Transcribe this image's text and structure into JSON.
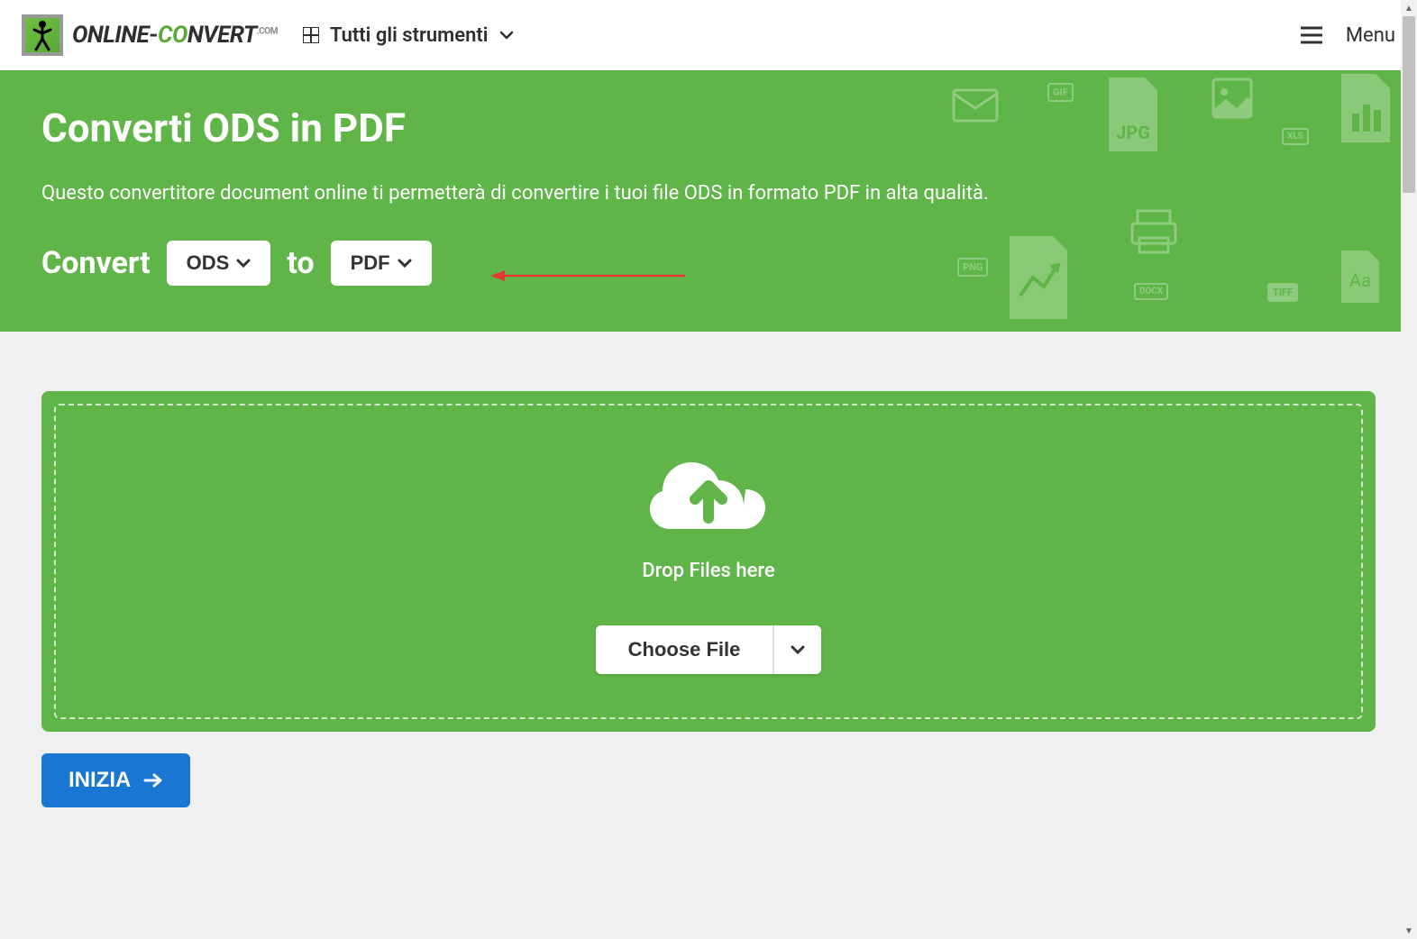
{
  "header": {
    "logo_text_online": "ONLINE",
    "logo_text_dash": "-",
    "logo_text_convert_co": "CO",
    "logo_text_convert_rest": "NVERT",
    "logo_text_com": ".COM",
    "tools_label": "Tutti gli strumenti",
    "menu_label": "Menu"
  },
  "hero": {
    "title": "Converti ODS in PDF",
    "description": "Questo convertitore document online ti permetterà di convertire i tuoi file ODS in formato PDF in alta qualità.",
    "convert_label": "Convert",
    "to_label": "to",
    "from_format": "ODS",
    "to_format": "PDF"
  },
  "upload": {
    "drop_text": "Drop Files here",
    "choose_file_label": "Choose File"
  },
  "actions": {
    "start_label": "INIZIA"
  },
  "bg_icon_labels": {
    "gif": "GIF",
    "jpg": "JPG",
    "xls": "XLS",
    "png": "PNG",
    "docx": "DOCX",
    "tiff": "TIFF"
  }
}
